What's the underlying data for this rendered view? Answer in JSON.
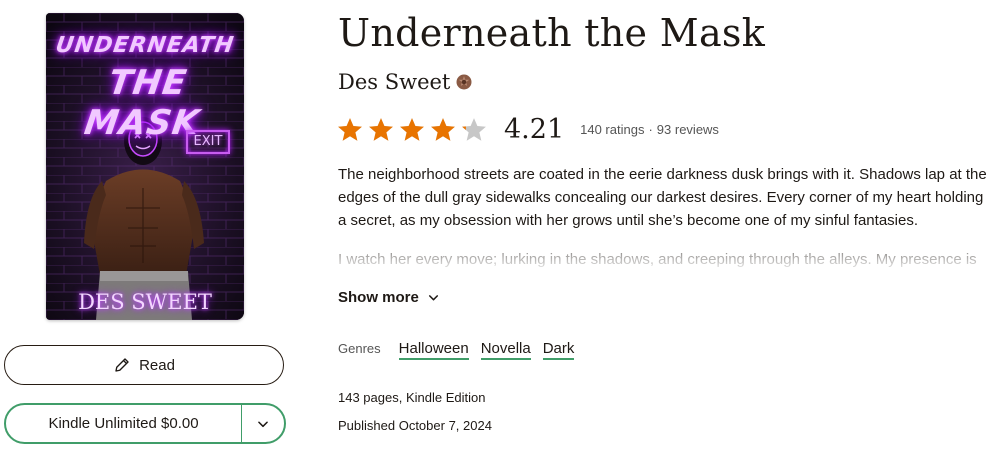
{
  "cover": {
    "title_line1": "UNDERNEATH",
    "title_line2": "THE MASK",
    "exit_sign": "EXIT",
    "author": "DES SWEET"
  },
  "book": {
    "title": "Underneath the Mask",
    "author": "Des Sweet",
    "rating": "4.21",
    "rating_fraction": 0.84,
    "ratings_count": "140 ratings",
    "separator": "·",
    "reviews_count": "93 reviews"
  },
  "description": {
    "para1": "The neighborhood streets are coated in the eerie darkness dusk brings with it. Shadows lap at the edges of the dull gray sidewalks concealing our darkest desires. Every corner of my heart holding a secret, as my obsession with her grows until she’s become one of my sinful fantasies.",
    "para2": "I watch her every move; lurking in the shadows, and creeping through the alleys. My presence is",
    "show_more": "Show more"
  },
  "genres": {
    "label": "Genres",
    "items": [
      "Halloween",
      "Novella",
      "Dark"
    ]
  },
  "details": {
    "pages_format": "143 pages, Kindle Edition",
    "published": "Published October 7, 2024"
  },
  "actions": {
    "read_label": "Read",
    "kindle_label": "Kindle Unlimited $0.00"
  },
  "colors": {
    "star_fill": "#e87400",
    "star_empty": "#c7c7c7",
    "accent_green": "#409d69",
    "author_badge": "#8a5a44"
  },
  "icons": {
    "read": "pencil-icon",
    "dropdown": "chevron-down-icon",
    "show_more": "chevron-down-icon",
    "author_badge": "author-badge-icon",
    "star": "star-icon"
  }
}
